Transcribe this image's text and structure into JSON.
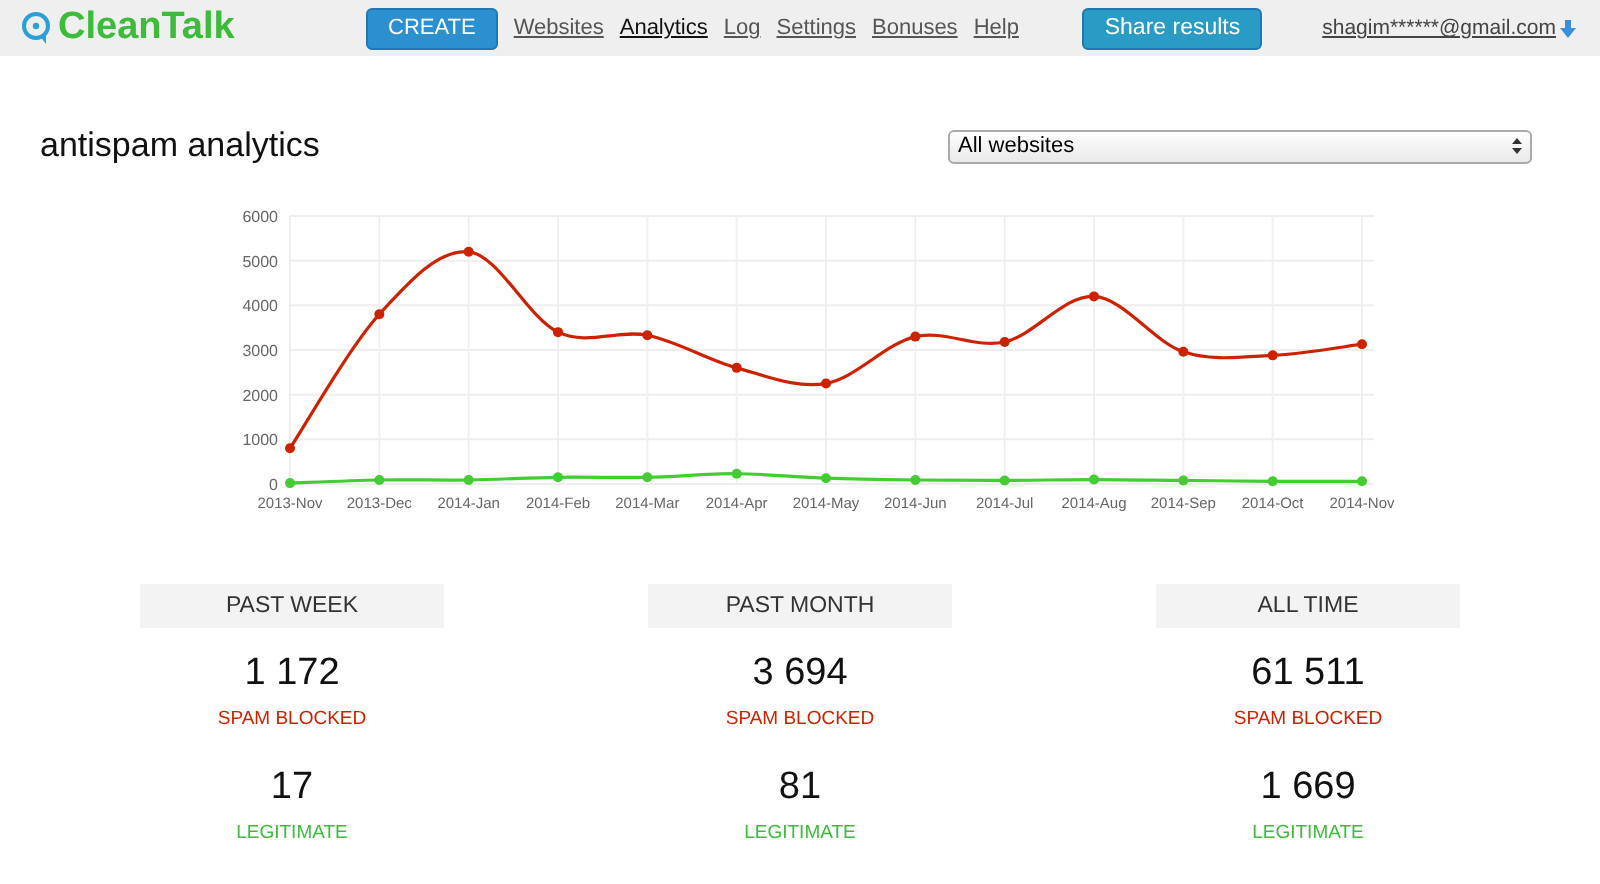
{
  "header": {
    "logo": "CleanTalk",
    "create_button": "CREATE",
    "nav": [
      {
        "label": "Websites",
        "selected": false
      },
      {
        "label": "Analytics",
        "selected": true
      },
      {
        "label": "Log",
        "selected": false
      },
      {
        "label": "Settings",
        "selected": false
      },
      {
        "label": "Bonuses",
        "selected": false
      },
      {
        "label": "Help",
        "selected": false
      }
    ],
    "share_button": "Share results",
    "account": "shagim******@gmail.com"
  },
  "title": "antispam analytics",
  "site_select": {
    "value": "All websites"
  },
  "chart_data": {
    "type": "line",
    "categories": [
      "2013-Nov",
      "2013-Dec",
      "2014-Jan",
      "2014-Feb",
      "2014-Mar",
      "2014-Apr",
      "2014-May",
      "2014-Jun",
      "2014-Jul",
      "2014-Aug",
      "2014-Sep",
      "2014-Oct",
      "2014-Nov"
    ],
    "yticks": [
      0,
      1000,
      2000,
      3000,
      4000,
      5000,
      6000
    ],
    "ylim": [
      0,
      6000
    ],
    "grid": true,
    "series": [
      {
        "color": "#cc2200",
        "marker": true,
        "values": [
          800,
          3800,
          5200,
          3400,
          3330,
          2600,
          2250,
          3300,
          3180,
          4200,
          2960,
          2880,
          3130
        ]
      },
      {
        "color": "#44cc33",
        "marker": true,
        "values": [
          20,
          90,
          90,
          150,
          150,
          230,
          130,
          90,
          80,
          100,
          80,
          60,
          60
        ]
      }
    ]
  },
  "stats": [
    {
      "period": "PAST WEEK",
      "spam": "1 172",
      "spam_label": "SPAM BLOCKED",
      "legit": "17",
      "legit_label": "LEGITIMATE"
    },
    {
      "period": "PAST MONTH",
      "spam": "3 694",
      "spam_label": "SPAM BLOCKED",
      "legit": "81",
      "legit_label": "LEGITIMATE"
    },
    {
      "period": "ALL TIME",
      "spam": "61 511",
      "spam_label": "SPAM BLOCKED",
      "legit": "1 669",
      "legit_label": "LEGITIMATE"
    }
  ]
}
